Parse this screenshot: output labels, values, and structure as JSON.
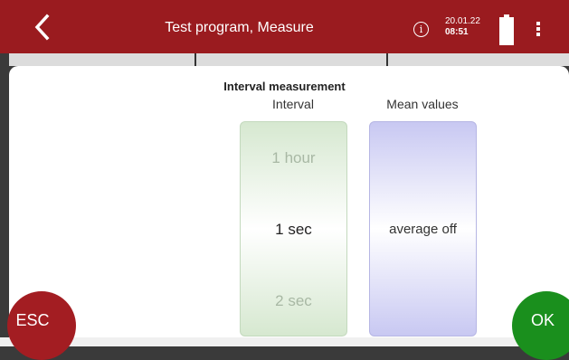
{
  "header": {
    "title": "Test program, Measure",
    "date": "20.01.22",
    "time": "08:51",
    "info_symbol": "i",
    "icons": [
      "chevron-left-icon",
      "info-icon",
      "battery-full-icon",
      "kebab-menu-icon"
    ]
  },
  "dialog": {
    "heading": "Interval measurement",
    "interval_label": "Interval",
    "mean_label": "Mean values",
    "interval_options": {
      "previous": "1 hour",
      "selected": "1 sec",
      "next": "2 sec"
    },
    "mean_selected": "average off"
  },
  "buttons": {
    "esc_label": "ESC",
    "ok_label": "OK"
  },
  "colors": {
    "header_bg": "#9a1b1f",
    "esc_bg": "#a31d22",
    "ok_bg": "#1a8f1d",
    "interval_wheel": "#d6e8d0",
    "mean_wheel": "#c8c8f2"
  }
}
